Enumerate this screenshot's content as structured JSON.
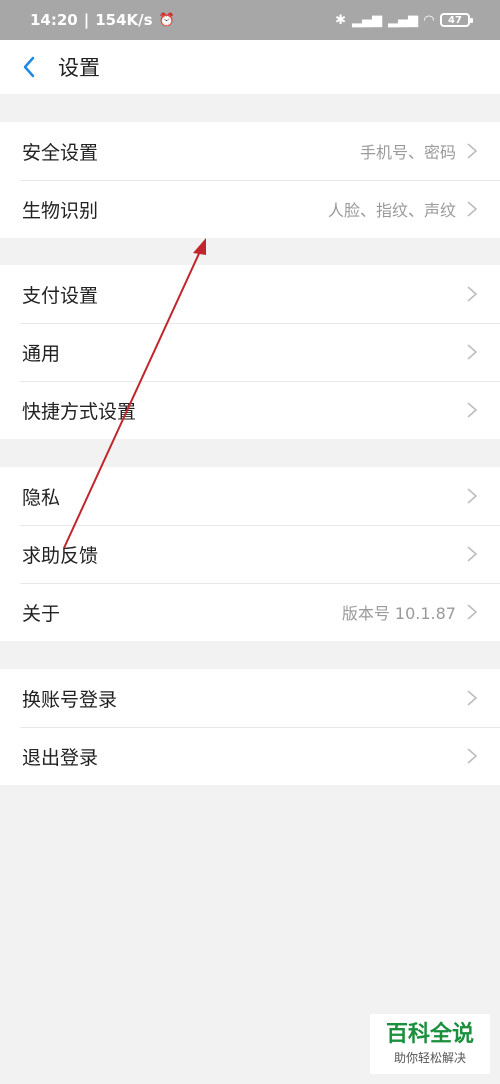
{
  "status_bar": {
    "time": "14:20",
    "speed": "154K/s",
    "battery": "47",
    "icons": [
      "alarm-icon",
      "bluetooth-icon",
      "signal-icon",
      "signal-icon",
      "wifi-icon",
      "battery-icon"
    ]
  },
  "header": {
    "title": "设置",
    "back_icon": "chevron-left-icon"
  },
  "groups": [
    {
      "items": [
        {
          "label": "安全设置",
          "value": "手机号、密码"
        },
        {
          "label": "生物识别",
          "value": "人脸、指纹、声纹"
        }
      ]
    },
    {
      "items": [
        {
          "label": "支付设置",
          "value": ""
        },
        {
          "label": "通用",
          "value": ""
        },
        {
          "label": "快捷方式设置",
          "value": ""
        }
      ]
    },
    {
      "items": [
        {
          "label": "隐私",
          "value": ""
        },
        {
          "label": "求助反馈",
          "value": ""
        },
        {
          "label": "关于",
          "value": "版本号 10.1.87"
        }
      ]
    },
    {
      "items": [
        {
          "label": "换账号登录",
          "value": ""
        },
        {
          "label": "退出登录",
          "value": ""
        }
      ]
    }
  ],
  "watermark": {
    "title": "百科全说",
    "subtitle": "助你轻松解决"
  },
  "colors": {
    "accent": "#1e88e5",
    "arrow": "#c0262b",
    "watermark": "#1a8f3c"
  }
}
